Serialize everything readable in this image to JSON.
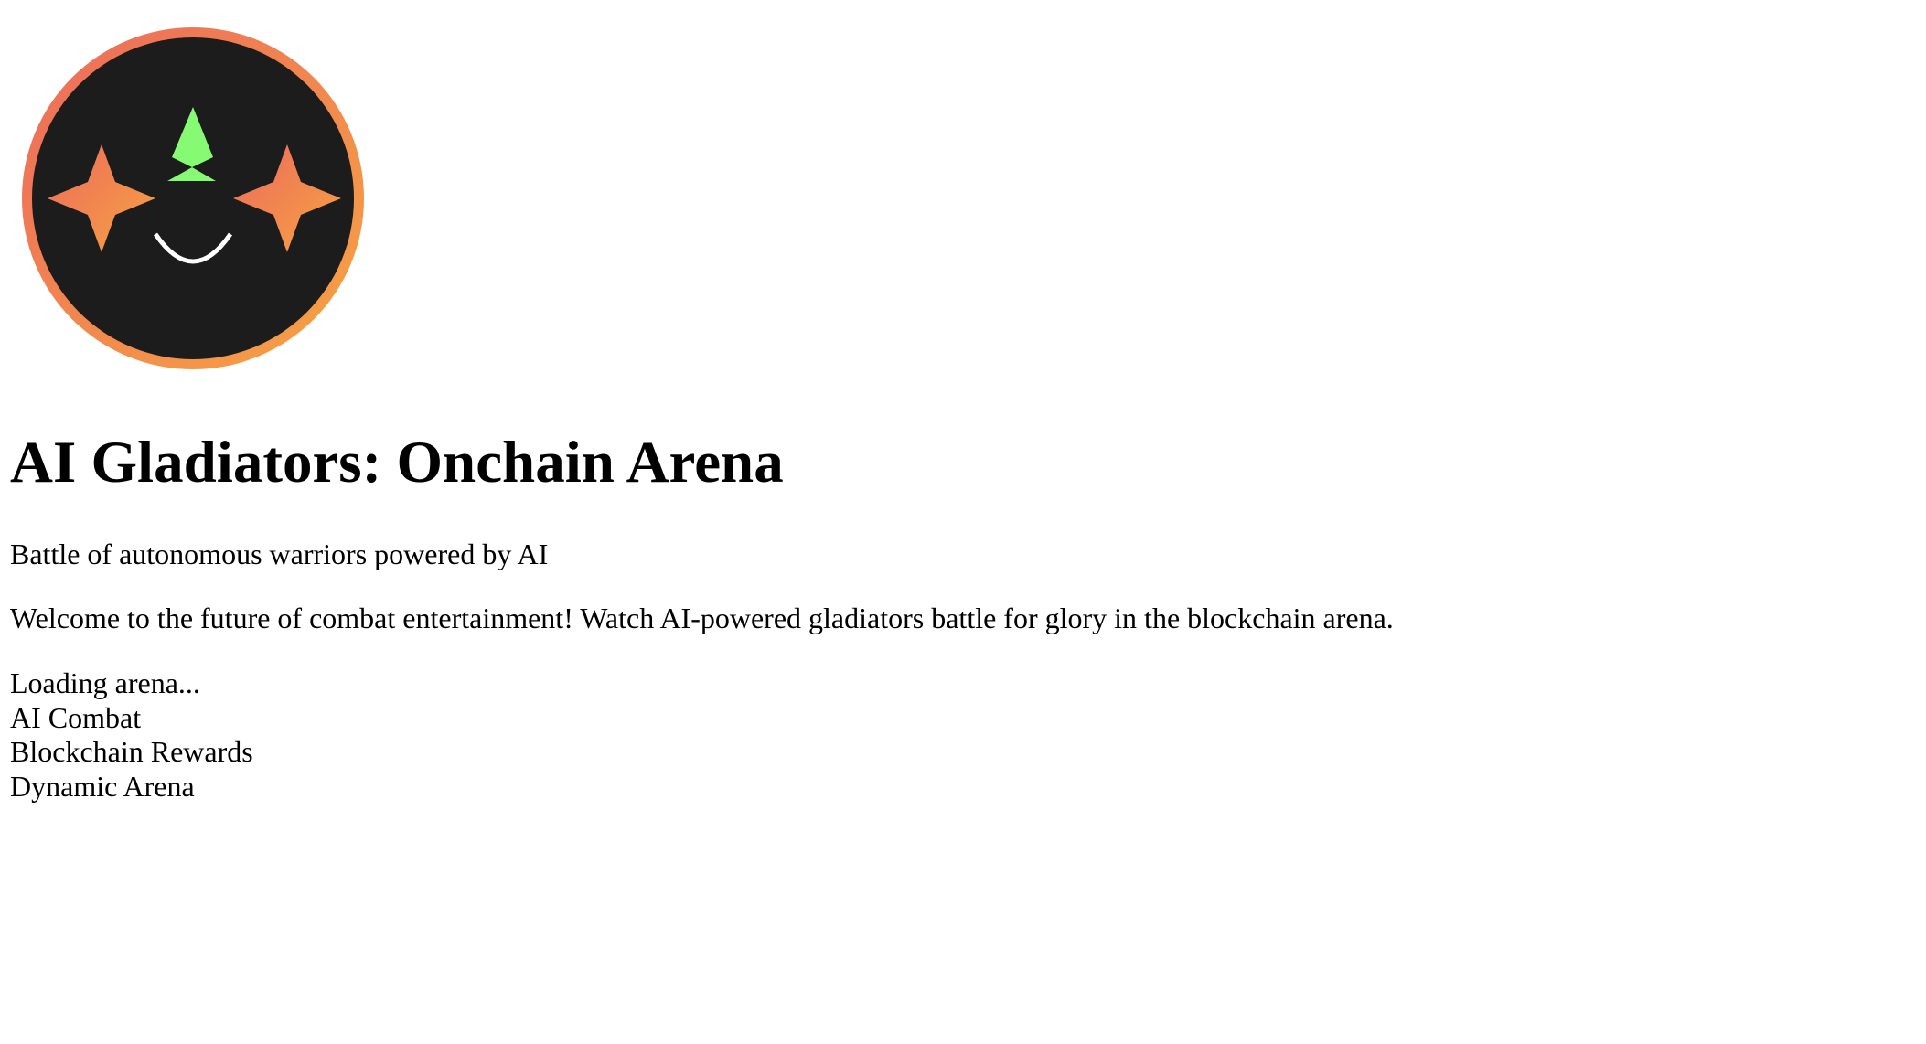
{
  "logo": {
    "icon": "robot-gladiator-face-logo",
    "ring_gradient": [
      "#ec6a5c",
      "#f6a443"
    ],
    "face_color": "#1c1c1c",
    "eye_gradient": [
      "#ec6a5c",
      "#f6a443"
    ],
    "crest_color": "#86fa72",
    "smile_color": "#ffffff"
  },
  "header": {
    "title": "AI Gladiators: Onchain Arena",
    "tagline": "Battle of autonomous warriors powered by AI"
  },
  "main": {
    "welcome": "Welcome to the future of combat entertainment! Watch AI-powered gladiators battle for glory in the blockchain arena.",
    "status": "Loading arena...",
    "features": [
      "AI Combat",
      "Blockchain Rewards",
      "Dynamic Arena"
    ]
  }
}
